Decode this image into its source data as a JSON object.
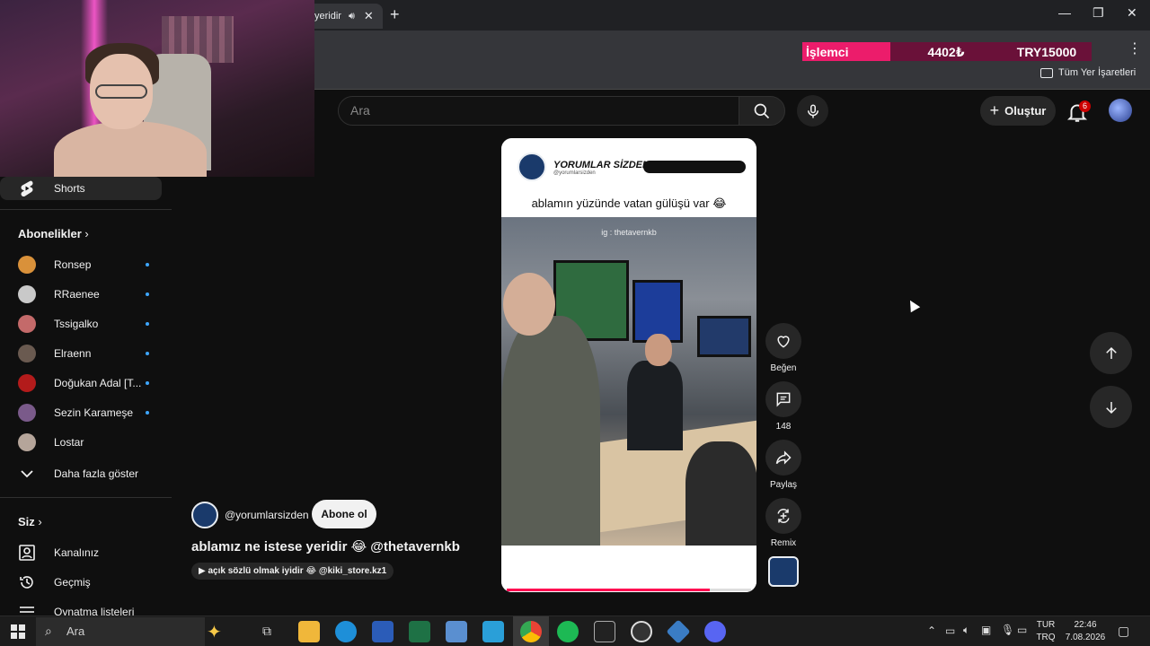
{
  "browser": {
    "tab_title": "yeridir",
    "bookmarks_all": "Tüm Yer İşaretleri",
    "cpu_widget": {
      "label": "İşlemci",
      "value": "4402₺",
      "target": "TRY15000"
    }
  },
  "header": {
    "search_placeholder": "Ara",
    "create_label": "Oluştur",
    "notification_count": "6"
  },
  "sidebar": {
    "shorts_label": "Shorts",
    "subscriptions_heading": "Abonelikler",
    "subscriptions": [
      {
        "name": "Ronsep",
        "color": "#d9913a"
      },
      {
        "name": "RRaenee",
        "color": "#c9c9c9"
      },
      {
        "name": "Tssigalko",
        "color": "#c46a6a"
      },
      {
        "name": "Elraenn",
        "color": "#6a5a50"
      },
      {
        "name": "Doğukan Adal [T...",
        "color": "#b31b1b"
      },
      {
        "name": "Sezin Karameşe",
        "color": "#7a5a8a"
      },
      {
        "name": "Lostar",
        "color": "#b5a59a"
      }
    ],
    "show_more": "Daha fazla göster",
    "you_heading": "Siz",
    "you_items": [
      "Kanalınız",
      "Geçmiş",
      "Oynatma listeleri"
    ]
  },
  "video": {
    "brand_title": "YORUMLAR SİZDEN",
    "brand_handle": "@yorumlarsizden",
    "caption": "ablamın yüzünde vatan gülüşü var 😂",
    "watermark": "ig : thetavernkb",
    "progress": 0.83
  },
  "actions": {
    "like_label": "Beğen",
    "comment_count": "148",
    "share_label": "Paylaş",
    "remix_label": "Remix"
  },
  "channel": {
    "handle": "@yorumlarsizden",
    "subscribe_label": "Abone ol",
    "title": "ablamız ne istese yeridir 😂 @thetavernkb",
    "music": "▶ açık sözlü olmak iyidir 😂 @kiki_store.kz1"
  },
  "taskbar": {
    "search_placeholder": "Ara",
    "lang_top": "TUR",
    "lang_bottom": "TRQ",
    "time": "22:46",
    "date": "7.08.2026"
  }
}
